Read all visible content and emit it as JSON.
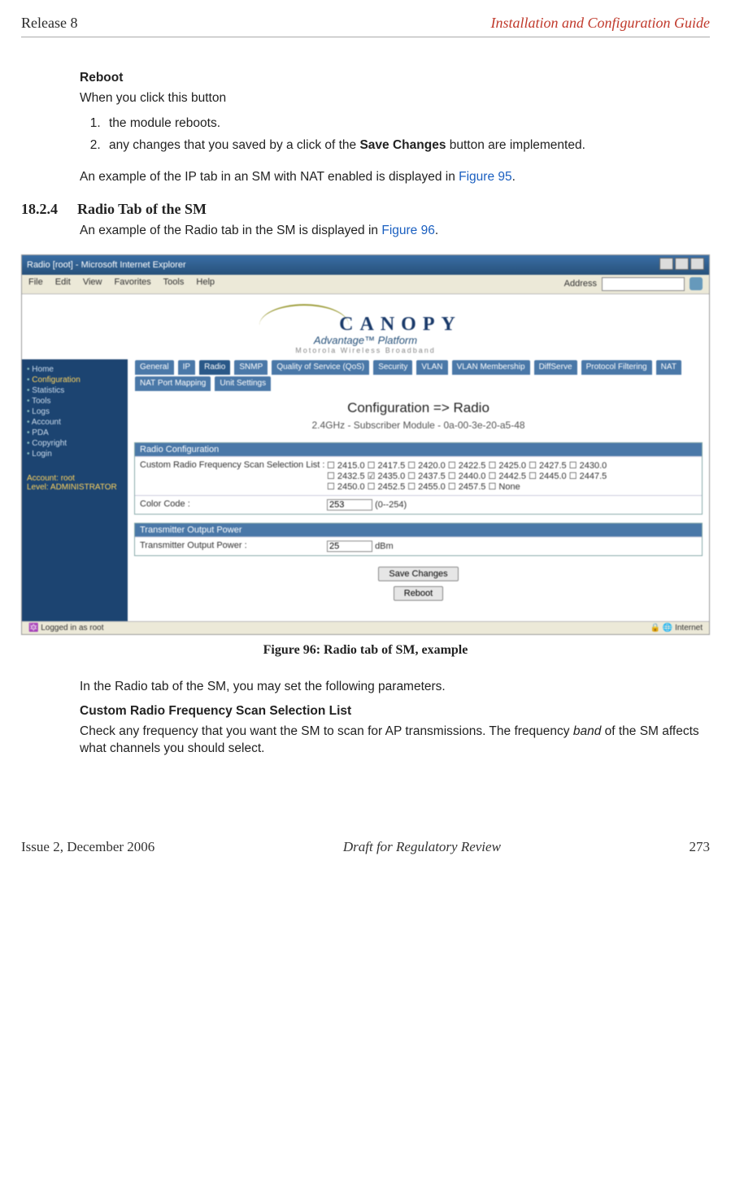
{
  "page_header": {
    "left": "Release 8",
    "right": "Installation and Configuration Guide"
  },
  "reboot_section": {
    "title": "Reboot",
    "intro": "When you click this button",
    "items": [
      "the module reboots.",
      "any changes that you saved by a click of the Save Changes button are implemented."
    ],
    "strong_in_item2": "Save Changes"
  },
  "ip_tab_sentence_pre": "An example of the IP tab in an SM with NAT enabled is displayed in ",
  "ip_tab_link": "Figure 95",
  "section": {
    "num": "18.2.4",
    "title": "Radio Tab of the SM"
  },
  "radio_sentence_pre": "An example of the Radio tab in the SM is displayed in ",
  "radio_link": "Figure 96",
  "screenshot": {
    "title": "Radio [root] - Microsoft Internet Explorer",
    "menus": [
      "File",
      "Edit",
      "View",
      "Favorites",
      "Tools",
      "Help"
    ],
    "address_label": "Address",
    "brand": "CANOPY",
    "brand_sub1": "Advantage™ Platform",
    "brand_sub2": "Motorola Wireless Broadband",
    "sidebar": {
      "items": [
        "Home",
        "Configuration",
        "Statistics",
        "Tools",
        "Logs",
        "Account",
        "PDA",
        "Copyright",
        "Login"
      ],
      "active": "Configuration",
      "account_label": "Account: root",
      "level_label": "Level: ADMINISTRATOR"
    },
    "tabs_row1": [
      "General",
      "IP",
      "Radio",
      "SNMP",
      "Quality of Service (QoS)",
      "Security",
      "VLAN",
      "VLAN Membership",
      "DiffServe",
      "Protocol Filtering",
      "NAT",
      "NAT Port Mapping",
      "Unit Settings"
    ],
    "active_tab": "Radio",
    "page_title": "Configuration => Radio",
    "page_sub": "2.4GHz - Subscriber Module - 0a-00-3e-20-a5-48",
    "panel1": {
      "header": "Radio Configuration",
      "row1_label": "Custom Radio Frequency Scan Selection List :",
      "freqs_line1": "☐ 2415.0 ☐ 2417.5 ☐ 2420.0 ☐ 2422.5 ☐ 2425.0 ☐ 2427.5 ☐ 2430.0",
      "freqs_line2": "☐ 2432.5 ☑ 2435.0 ☐ 2437.5 ☐ 2440.0 ☐ 2442.5 ☐ 2445.0 ☐ 2447.5",
      "freqs_line3": "☐ 2450.0 ☐ 2452.5 ☐ 2455.0 ☐ 2457.5 ☐  None",
      "row2_label": "Color Code :",
      "row2_value": "253",
      "row2_hint": "(0--254)"
    },
    "panel2": {
      "header": "Transmitter Output Power",
      "row1_label": "Transmitter Output Power :",
      "row1_value": "25",
      "row1_unit": "dBm"
    },
    "btn_save": "Save Changes",
    "btn_reboot": "Reboot",
    "status_left": "Logged in as root",
    "status_right": "Internet"
  },
  "figure_caption": "Figure 96: Radio tab of SM, example",
  "radio_intro": "In the Radio tab of the SM, you may set the following parameters.",
  "custom_freq": {
    "title": "Custom Radio Frequency Scan Selection List",
    "body_pre": "Check any frequency that you want the SM to scan for AP transmissions. The frequency ",
    "body_em": "band",
    "body_post": " of the SM affects what channels you should select."
  },
  "page_footer": {
    "left": "Issue 2, December 2006",
    "mid": "Draft for Regulatory Review",
    "right": "273"
  }
}
